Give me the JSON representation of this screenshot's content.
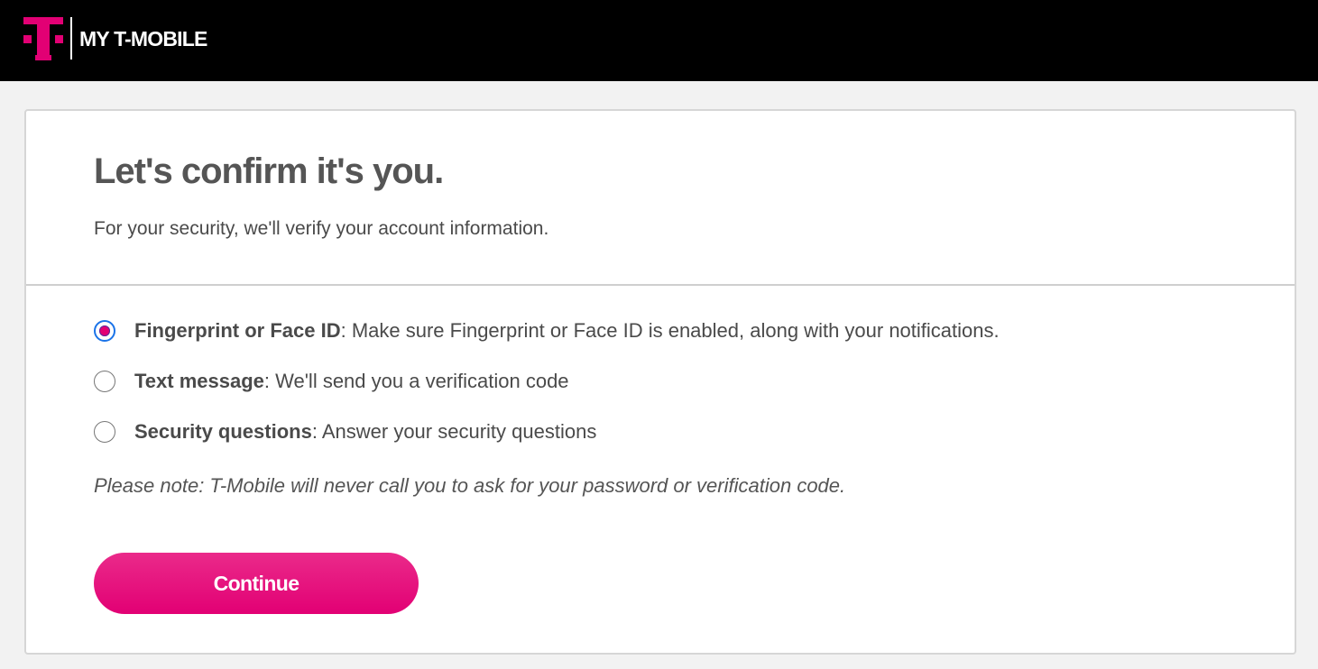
{
  "header": {
    "brand_name": "MY T-MOBILE",
    "logo_icon": "t-mobile-logo-icon",
    "background_color": "#000000",
    "brand_color": "#e20074"
  },
  "main": {
    "heading": "Let's confirm it's you.",
    "subtext": "For your security, we'll verify your account information.",
    "options": [
      {
        "title": "Fingerprint or Face ID",
        "description": ": Make sure Fingerprint or Face ID is enabled, along with your notifications.",
        "selected": true
      },
      {
        "title": "Text message",
        "description": ": We'll send you a verification code",
        "selected": false
      },
      {
        "title": "Security questions",
        "description": ": Answer your security questions",
        "selected": false
      }
    ],
    "note": "Please note: T-Mobile will never call you to ask for your password or verification code.",
    "continue_label": "Continue"
  }
}
